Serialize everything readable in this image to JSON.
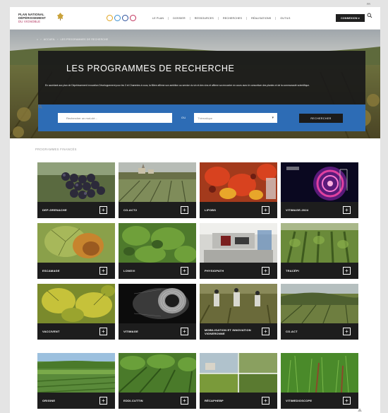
{
  "header": {
    "logo": {
      "line1": "PLAN NATIONAL",
      "line2": "DÉPÉRISSEMENT",
      "line3": "DU VIGNOBLE"
    },
    "nav": [
      "LE PLAN",
      "DOSSIER",
      "RESSOURCES",
      "RECHERCHES",
      "RÉALISATIONS",
      "OUTILS"
    ],
    "connect_label": "CONNEXION ▾",
    "lang": "FR"
  },
  "hero": {
    "breadcrumb": [
      "⌂",
      "›",
      "ACCUEIL",
      "›",
      "LES PROGRAMMES DE RECHERCHE"
    ],
    "title": "LES PROGRAMMES DE RECHERCHE",
    "text": "En accédant aux plan de Dépérissement Innovation Développement pour les 3 et Charentes à vous, la filière affirme son ambition au service du vin et des vins et affirme sa rencontre en cours avec le consortium des plantes et de la communauté scientifique.",
    "search": {
      "keyword_placeholder": "Rechercher un mot-clé...",
      "or": "OU",
      "theme_placeholder": "Thématique",
      "button": "RECHERCHER"
    }
  },
  "content": {
    "section_title": "PROGRAMMES FINANCÉS",
    "cards": [
      {
        "label": "DEP-GRENACHE",
        "img": "grapes"
      },
      {
        "label": "CO-ACT2",
        "img": "village"
      },
      {
        "label": "LIPOBS",
        "img": "redleaves"
      },
      {
        "label": "VITIMAGE-2024",
        "img": "scan"
      },
      {
        "label": "ESCAMAGE",
        "img": "leafdisease"
      },
      {
        "label": "LONGVI",
        "img": "leaves"
      },
      {
        "label": "PHYSIOPATH",
        "img": "lab"
      },
      {
        "label": "TRACÉPI",
        "img": "vinerows"
      },
      {
        "label": "VACCIVENT",
        "img": "yellowleaves"
      },
      {
        "label": "VITIMAGE",
        "img": "trunkscan"
      },
      {
        "label": "MOBILISATION ET INNOVATION VIGNERONNE",
        "img": "people"
      },
      {
        "label": "CO-ACT",
        "img": "hillside"
      },
      {
        "label": "ORIGINE",
        "img": "landscape"
      },
      {
        "label": "EDDI-CUTTIN",
        "img": "rows"
      },
      {
        "label": "RÉCAPHEBP",
        "img": "collage"
      },
      {
        "label": "VITIMEDIOSCOPE",
        "img": "grass"
      }
    ]
  },
  "colors": {
    "accent": "#2d6cb5",
    "dark": "#1d1d1d",
    "brand": "#b0305b"
  }
}
